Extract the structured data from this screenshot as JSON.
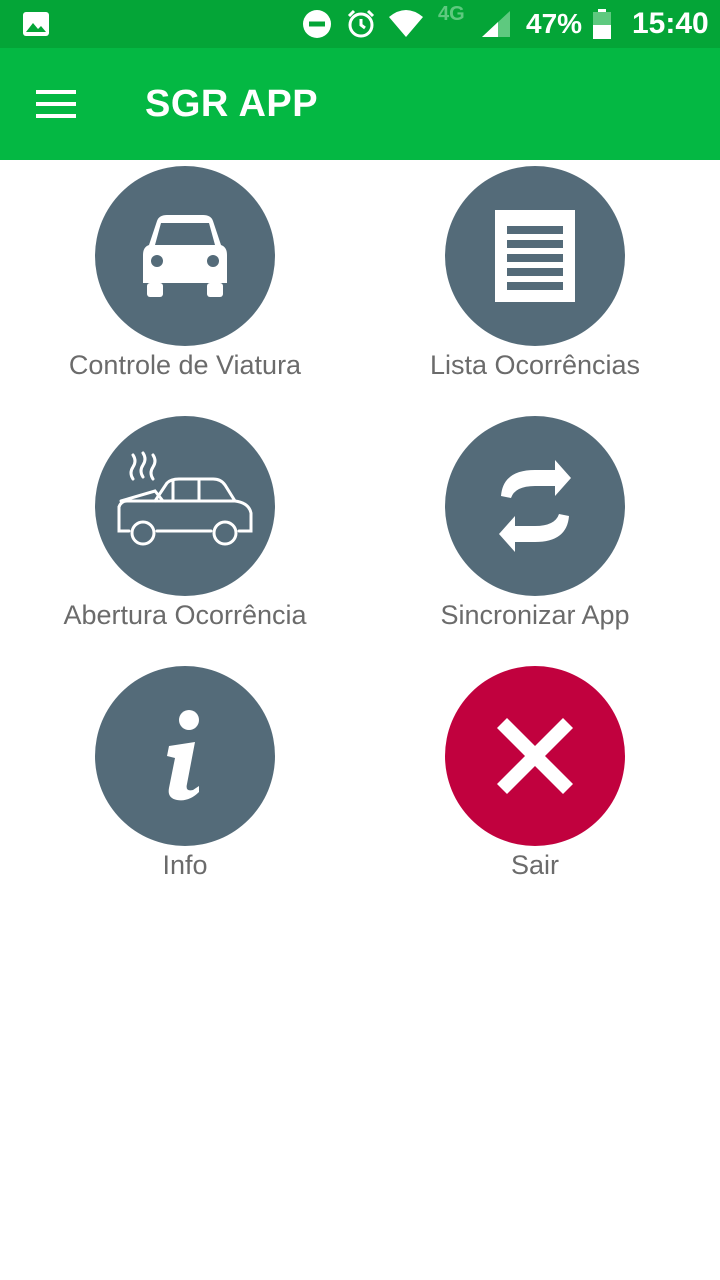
{
  "status_bar": {
    "icons": [
      "gallery-icon",
      "do-not-disturb-icon",
      "alarm-icon",
      "wifi-icon",
      "signal-icon",
      "battery-icon"
    ],
    "network": "4G",
    "battery_percent": "47%",
    "time": "15:40"
  },
  "app_bar": {
    "title": "SGR APP",
    "menu_icon": "hamburger-menu-icon",
    "background": "#04b843"
  },
  "menu": {
    "items": [
      {
        "label": "Controle de Viatura",
        "icon": "car-icon",
        "color": "#546b79"
      },
      {
        "label": "Lista Ocorrências",
        "icon": "document-list-icon",
        "color": "#546b79"
      },
      {
        "label": "Abertura Ocorrência",
        "icon": "car-breakdown-icon",
        "color": "#546b79"
      },
      {
        "label": "Sincronizar App",
        "icon": "sync-icon",
        "color": "#546b79"
      },
      {
        "label": "Info",
        "icon": "info-icon",
        "color": "#546b79"
      },
      {
        "label": "Sair",
        "icon": "close-icon",
        "color": "#c1013e"
      }
    ]
  }
}
